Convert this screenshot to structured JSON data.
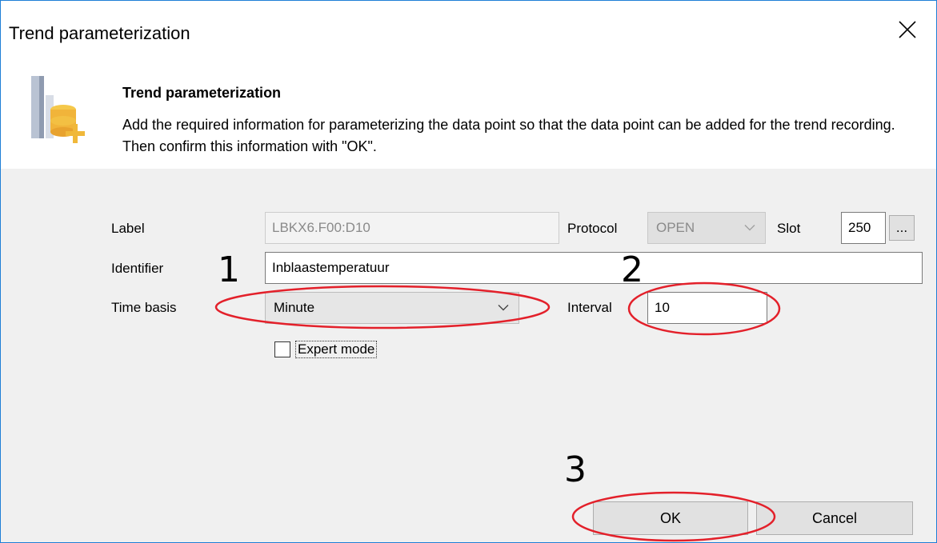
{
  "window": {
    "title": "Trend parameterization"
  },
  "header": {
    "title": "Trend parameterization",
    "description": "Add the required information for parameterizing the data point so that the data point can be added for the trend recording. Then confirm this information with \"OK\"."
  },
  "form": {
    "label": {
      "caption": "Label",
      "value": "LBKX6.F00:D10"
    },
    "protocol": {
      "caption": "Protocol",
      "value": "OPEN"
    },
    "slot": {
      "caption": "Slot",
      "value": "250",
      "browse_label": "..."
    },
    "identifier": {
      "caption": "Identifier",
      "value": "Inblaastemperatuur"
    },
    "time_basis": {
      "caption": "Time basis",
      "value": "Minute"
    },
    "interval": {
      "caption": "Interval",
      "value": "10"
    },
    "expert_mode": {
      "caption": "Expert mode",
      "checked": false
    }
  },
  "buttons": {
    "ok": "OK",
    "cancel": "Cancel"
  },
  "annotations": {
    "one": "1",
    "two": "2",
    "three": "3",
    "ellipse_color": "#e3202a"
  },
  "icons": [
    "close-icon",
    "trend-database-add-icon",
    "chevron-down-icon"
  ]
}
